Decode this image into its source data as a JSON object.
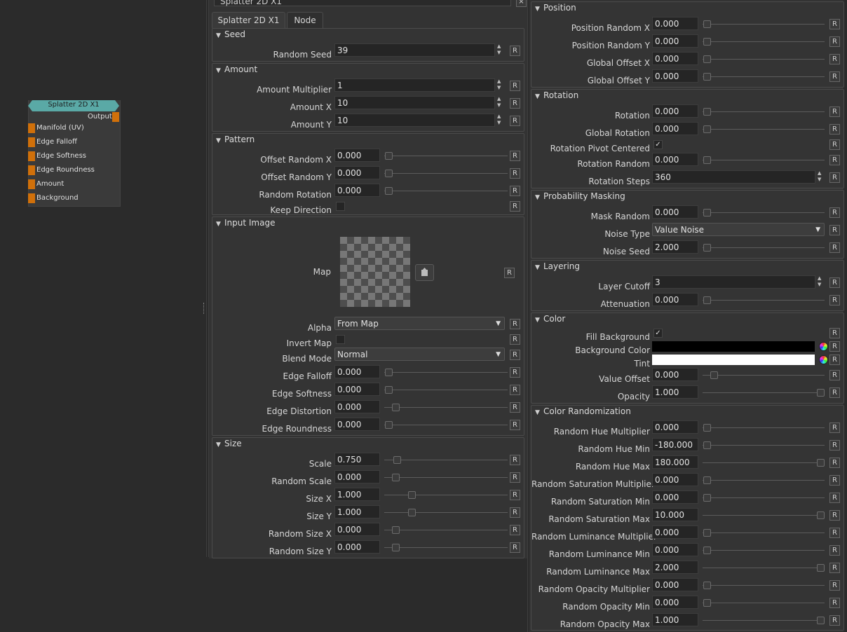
{
  "node": {
    "title": "Splatter 2D X1",
    "output": "Output",
    "ports": [
      "Manifold (UV)",
      "Edge Falloff",
      "Edge Softness",
      "Edge Roundness",
      "Amount",
      "Background"
    ]
  },
  "panel": {
    "title": "Splatter 2D X1",
    "tabs": [
      "Splatter 2D X1",
      "Node"
    ],
    "reset_label": "R",
    "map_label": "Map",
    "map_load_icon": "import-image-icon",
    "groups": {
      "seed": "Seed",
      "amount": "Amount",
      "pattern": "Pattern",
      "input_image": "Input Image",
      "size": "Size",
      "position": "Position",
      "rotation": "Rotation",
      "probability_masking": "Probability Masking",
      "layering": "Layering",
      "color": "Color",
      "color_randomization": "Color Randomization"
    }
  },
  "left_params": [
    {
      "key": "random_seed",
      "label": "Random Seed",
      "value": "39",
      "type": "spin"
    },
    {
      "key": "amount_multiplier",
      "label": "Amount Multiplier",
      "value": "1",
      "type": "spin"
    },
    {
      "key": "amount_x",
      "label": "Amount X",
      "value": "10",
      "type": "spin"
    },
    {
      "key": "amount_y",
      "label": "Amount Y",
      "value": "10",
      "type": "spin"
    },
    {
      "key": "offset_random_x",
      "label": "Offset Random X",
      "value": "0.000",
      "type": "slider",
      "level": 0.0
    },
    {
      "key": "offset_random_y",
      "label": "Offset Random Y",
      "value": "0.000",
      "type": "slider",
      "level": 0.0
    },
    {
      "key": "random_rotation",
      "label": "Random Rotation",
      "value": "0.000",
      "type": "slider",
      "level": 0.0
    },
    {
      "key": "keep_direction",
      "label": "Keep Direction",
      "checked": false,
      "type": "check"
    },
    {
      "key": "alpha",
      "label": "Alpha",
      "value": "From Map",
      "type": "drop"
    },
    {
      "key": "invert_map",
      "label": "Invert Map",
      "checked": false,
      "type": "check"
    },
    {
      "key": "blend_mode",
      "label": "Blend Mode",
      "value": "Normal",
      "type": "drop"
    },
    {
      "key": "edge_falloff",
      "label": "Edge Falloff",
      "value": "0.000",
      "type": "slider",
      "level": 0.0
    },
    {
      "key": "edge_softness",
      "label": "Edge Softness",
      "value": "0.000",
      "type": "slider",
      "level": 0.0
    },
    {
      "key": "edge_distortion",
      "label": "Edge Distortion",
      "value": "0.000",
      "type": "slider",
      "level": 0.06
    },
    {
      "key": "edge_roundness",
      "label": "Edge Roundness",
      "value": "0.000",
      "type": "slider",
      "level": 0.0
    },
    {
      "key": "scale",
      "label": "Scale",
      "value": "0.750",
      "type": "slider",
      "level": 0.075
    },
    {
      "key": "random_scale",
      "label": "Random Scale",
      "value": "0.000",
      "type": "slider",
      "level": 0.06
    },
    {
      "key": "size_x",
      "label": "Size X",
      "value": "1.000",
      "type": "slider",
      "level": 0.2
    },
    {
      "key": "size_y",
      "label": "Size Y",
      "value": "1.000",
      "type": "slider",
      "level": 0.2
    },
    {
      "key": "random_size_x",
      "label": "Random Size X",
      "value": "0.000",
      "type": "slider",
      "level": 0.06
    },
    {
      "key": "random_size_y",
      "label": "Random Size Y",
      "value": "0.000",
      "type": "slider",
      "level": 0.06
    }
  ],
  "right_params": [
    {
      "key": "position_random_x",
      "label": "Position Random X",
      "value": "0.000",
      "type": "slider",
      "level": 0.0
    },
    {
      "key": "position_random_y",
      "label": "Position Random Y",
      "value": "0.000",
      "type": "slider",
      "level": 0.0
    },
    {
      "key": "global_offset_x",
      "label": "Global Offset X",
      "value": "0.000",
      "type": "slider",
      "level": 0.0
    },
    {
      "key": "global_offset_y",
      "label": "Global Offset Y",
      "value": "0.000",
      "type": "slider",
      "level": 0.0
    },
    {
      "key": "rotation",
      "label": "Rotation",
      "value": "0.000",
      "type": "slider",
      "level": 0.0
    },
    {
      "key": "global_rotation",
      "label": "Global Rotation",
      "value": "0.000",
      "type": "slider",
      "level": 0.0
    },
    {
      "key": "rotation_pivot_centered",
      "label": "Rotation Pivot Centered",
      "checked": true,
      "type": "check"
    },
    {
      "key": "rotation_random",
      "label": "Rotation Random",
      "value": "0.000",
      "type": "slider",
      "level": 0.0
    },
    {
      "key": "rotation_steps",
      "label": "Rotation Steps",
      "value": "360",
      "type": "spin"
    },
    {
      "key": "mask_random",
      "label": "Mask Random",
      "value": "0.000",
      "type": "slider",
      "level": 0.0
    },
    {
      "key": "noise_type",
      "label": "Noise Type",
      "value": "Value Noise",
      "type": "drop"
    },
    {
      "key": "noise_seed",
      "label": "Noise Seed",
      "value": "2.000",
      "type": "slider",
      "level": 0.0
    },
    {
      "key": "layer_cutoff",
      "label": "Layer Cutoff",
      "value": "3",
      "type": "spin"
    },
    {
      "key": "attenuation",
      "label": "Attenuation",
      "value": "0.000",
      "type": "slider",
      "level": 0.0
    },
    {
      "key": "fill_background",
      "label": "Fill Background",
      "checked": true,
      "type": "check"
    },
    {
      "key": "background_color",
      "label": "Background Color",
      "color": "#000000",
      "type": "color"
    },
    {
      "key": "tint",
      "label": "Tint",
      "color": "#ffffff",
      "type": "color"
    },
    {
      "key": "value_offset",
      "label": "Value Offset",
      "value": "0.000",
      "type": "slider",
      "level": 0.06
    },
    {
      "key": "opacity",
      "label": "Opacity",
      "value": "1.000",
      "type": "slider",
      "level": 1.0
    },
    {
      "key": "random_hue_multiplier",
      "label": "Random Hue Multiplier",
      "value": "0.000",
      "type": "slider",
      "level": 0.0
    },
    {
      "key": "random_hue_min",
      "label": "Random Hue Min",
      "value": "-180.000",
      "type": "slider",
      "level": 0.0
    },
    {
      "key": "random_hue_max",
      "label": "Random Hue Max",
      "value": "180.000",
      "type": "slider",
      "level": 1.0
    },
    {
      "key": "random_saturation_multiplier",
      "label": "Random Saturation Multiplier",
      "value": "0.000",
      "type": "slider",
      "level": 0.0
    },
    {
      "key": "random_saturation_min",
      "label": "Random Saturation Min",
      "value": "0.000",
      "type": "slider",
      "level": 0.0
    },
    {
      "key": "random_saturation_max",
      "label": "Random Saturation Max",
      "value": "10.000",
      "type": "slider",
      "level": 1.0
    },
    {
      "key": "random_luminance_multiplier",
      "label": "Random Luminance Multiplier",
      "value": "0.000",
      "type": "slider",
      "level": 0.0
    },
    {
      "key": "random_luminance_min",
      "label": "Random Luminance Min",
      "value": "0.000",
      "type": "slider",
      "level": 0.0
    },
    {
      "key": "random_luminance_max",
      "label": "Random Luminance Max",
      "value": "2.000",
      "type": "slider",
      "level": 1.0
    },
    {
      "key": "random_opacity_multiplier",
      "label": "Random Opacity Multiplier",
      "value": "0.000",
      "type": "slider",
      "level": 0.0
    },
    {
      "key": "random_opacity_min",
      "label": "Random Opacity Min",
      "value": "0.000",
      "type": "slider",
      "level": 0.0
    },
    {
      "key": "random_opacity_max",
      "label": "Random Opacity Max",
      "value": "1.000",
      "type": "slider",
      "level": 1.0
    }
  ],
  "colors": {
    "accent_node": "#5aa9a6",
    "port": "#d0700a"
  }
}
